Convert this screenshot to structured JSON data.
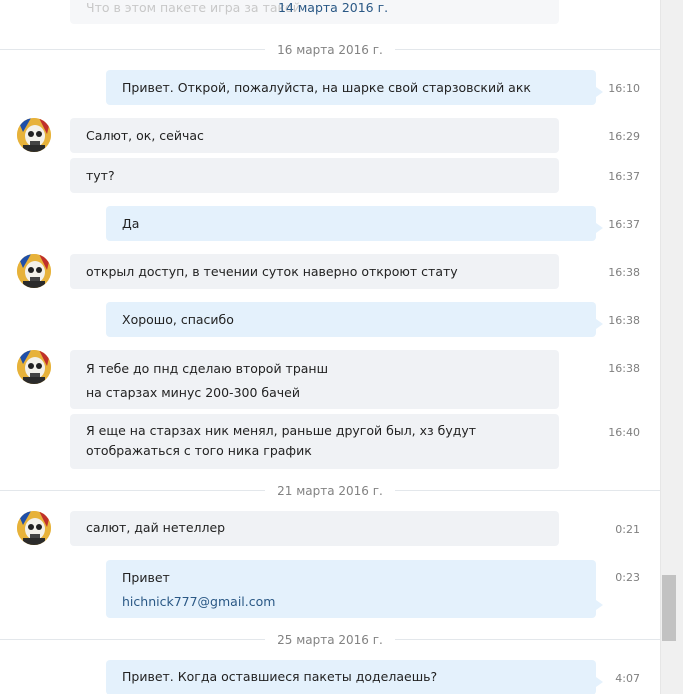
{
  "top_partial": {
    "text": "Что в этом пакете игра за такой",
    "date": "14 марта 2016 г."
  },
  "dates": [
    "16 марта 2016 г.",
    "21 марта 2016 г.",
    "25 марта 2016 г."
  ],
  "messages": [
    {
      "text": "Привет. Открой, пожалуйста, на шарке свой старзовский акк",
      "time": "16:10"
    },
    {
      "text": "Салют, ок, сейчас",
      "time": "16:29"
    },
    {
      "text": "тут?",
      "time": "16:37"
    },
    {
      "text": "Да",
      "time": "16:37"
    },
    {
      "text": "открыл доступ, в течении суток наверно откроют стату",
      "time": "16:38"
    },
    {
      "text": "Хорошо, спасибо",
      "time": "16:38"
    },
    {
      "lines": [
        "Я тебе до пнд сделаю второй транш",
        "на старзах минус 200-300 бачей"
      ],
      "time": "16:38"
    },
    {
      "lines": [
        "Я еще на старзах ник менял, раньше другой был, хз будут",
        "отображаться с того ника график"
      ],
      "time": "16:40"
    },
    {
      "text": "салют, дай нетеллер",
      "time": "0:21"
    },
    {
      "lines": [
        "Привет",
        "hichnick777@gmail.com"
      ],
      "time": "0:23"
    },
    {
      "text": "Привет. Когда оставшиеся пакеты доделаешь?",
      "time": "4:07"
    }
  ]
}
